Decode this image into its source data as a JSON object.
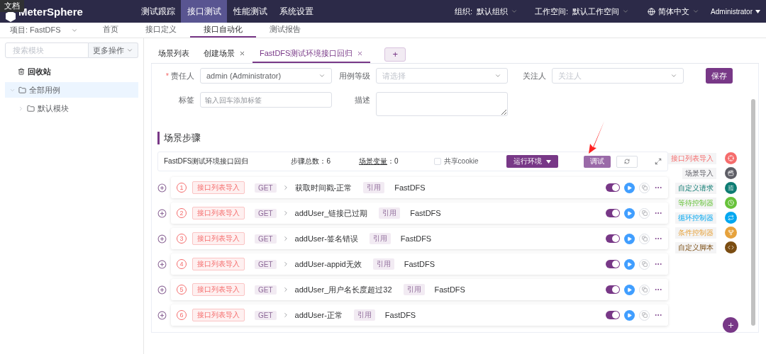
{
  "tooltip": "文档",
  "logo": "MeterSphere",
  "top_nav": [
    {
      "label": "测试跟踪",
      "selected": false
    },
    {
      "label": "接口测试",
      "selected": true
    },
    {
      "label": "性能测试",
      "selected": false
    },
    {
      "label": "系统设置",
      "selected": false
    }
  ],
  "org": {
    "label": "组织:",
    "value": "默认组织"
  },
  "workspace": {
    "label": "工作空间:",
    "value": "默认工作空间"
  },
  "language": "简体中文",
  "user": "Administrator",
  "project": "项目: FastDFS",
  "sub_nav": [
    {
      "label": "首页",
      "selected": false
    },
    {
      "label": "接口定义",
      "selected": false
    },
    {
      "label": "接口自动化",
      "selected": true
    },
    {
      "label": "测试报告",
      "selected": false
    }
  ],
  "sidebar": {
    "search_placeholder": "搜索模块",
    "more_button": "更多操作",
    "trash": "回收站",
    "tree": [
      {
        "label": "全部用例",
        "expanded": true,
        "selected": true,
        "children": [
          {
            "label": "默认模块",
            "expanded": false,
            "selected": false
          }
        ]
      }
    ]
  },
  "tabs": [
    {
      "label": "场景列表",
      "closable": false,
      "selected": false
    },
    {
      "label": "创建场景",
      "closable": true,
      "selected": false
    },
    {
      "label": "FastDFS测试环境接口回归",
      "closable": true,
      "selected": true
    }
  ],
  "add_tab": "+",
  "form": {
    "required_mark": "*",
    "owner_label": "责任人",
    "owner_value": "admin (Administrator)",
    "level_label": "用例等级",
    "level_placeholder": "请选择",
    "follower_label": "关注人",
    "follower_placeholder": "关注人",
    "save": "保存",
    "tag_label": "标签",
    "tag_placeholder": "输入回车添加标签",
    "desc_label": "描述"
  },
  "section_title": "场景步骤",
  "scenario_bar": {
    "name": "FastDFS测试环境接口回归",
    "steps_label": "步骤总数：6",
    "variables_label": "场景变量",
    "variables_value": "：0",
    "share_cookie": {
      "label": "共享cookie",
      "checked": false
    },
    "env_button": "运行环境",
    "debug_button": "调试"
  },
  "steps": [
    {
      "index": "1",
      "source": "接口列表导入",
      "method": "GET",
      "name": "获取时间戳-正常",
      "ref": "引用",
      "project": "FastDFS",
      "enabled": true
    },
    {
      "index": "2",
      "source": "接口列表导入",
      "method": "GET",
      "name": "addUser_链接已过期",
      "ref": "引用",
      "project": "FastDFS",
      "enabled": true
    },
    {
      "index": "3",
      "source": "接口列表导入",
      "method": "GET",
      "name": "addUser-签名错误",
      "ref": "引用",
      "project": "FastDFS",
      "enabled": true
    },
    {
      "index": "4",
      "source": "接口列表导入",
      "method": "GET",
      "name": "addUser-appid无效",
      "ref": "引用",
      "project": "FastDFS",
      "enabled": true
    },
    {
      "index": "5",
      "source": "接口列表导入",
      "method": "GET",
      "name": "addUser_用户名长度超过32",
      "ref": "引用",
      "project": "FastDFS",
      "enabled": true
    },
    {
      "index": "6",
      "source": "接口列表导入",
      "method": "GET",
      "name": "addUser-正常",
      "ref": "引用",
      "project": "FastDFS",
      "enabled": true
    }
  ],
  "add_menu": [
    {
      "label": "接口列表导入",
      "color": "#f56c6c",
      "kind": "api"
    },
    {
      "label": "场景导入",
      "color": "#5e5e66",
      "kind": "scenario"
    },
    {
      "label": "自定义请求",
      "color": "#0e7c73",
      "kind": "request"
    },
    {
      "label": "等待控制器",
      "color": "#67c23a",
      "kind": "wait"
    },
    {
      "label": "循环控制器",
      "color": "#02a7f0",
      "kind": "loop"
    },
    {
      "label": "条件控制器",
      "color": "#e6a23c",
      "kind": "if"
    },
    {
      "label": "自定义脚本",
      "color": "#7b4d12",
      "kind": "script"
    }
  ]
}
